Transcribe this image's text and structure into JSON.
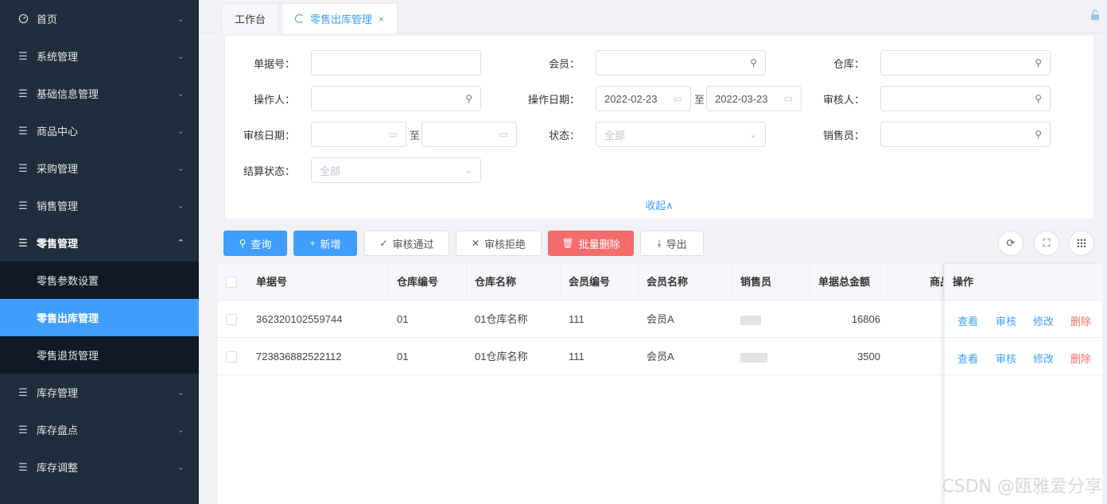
{
  "sidebar": {
    "items": [
      {
        "label": "首页",
        "icon": "dashboard-icon"
      },
      {
        "label": "系统管理",
        "icon": "menu-icon"
      },
      {
        "label": "基础信息管理",
        "icon": "menu-icon"
      },
      {
        "label": "商品中心",
        "icon": "menu-icon"
      },
      {
        "label": "采购管理",
        "icon": "menu-icon"
      },
      {
        "label": "销售管理",
        "icon": "menu-icon"
      },
      {
        "label": "零售管理",
        "icon": "menu-icon",
        "open": true
      },
      {
        "label": "库存管理",
        "icon": "menu-icon"
      },
      {
        "label": "库存盘点",
        "icon": "menu-icon"
      },
      {
        "label": "库存调整",
        "icon": "menu-icon"
      }
    ],
    "submenu": [
      {
        "label": "零售参数设置"
      },
      {
        "label": "零售出库管理",
        "active": true
      },
      {
        "label": "零售退货管理"
      }
    ]
  },
  "tabs": [
    {
      "label": "工作台"
    },
    {
      "label": "零售出库管理",
      "active": true,
      "close": "×"
    }
  ],
  "filter": {
    "order_no_label": "单据号：",
    "member_label": "会员：",
    "warehouse_label": "仓库：",
    "operator_label": "操作人：",
    "op_date_label": "操作日期：",
    "op_date_start": "2022-02-23",
    "op_date_end": "2022-03-23",
    "auditor_label": "审核人：",
    "audit_date_label": "审核日期：",
    "status_label": "状态：",
    "status_placeholder": "全部",
    "salesman_label": "销售员：",
    "settle_label": "结算状态：",
    "settle_placeholder": "全部",
    "to_text": "至",
    "collapse_label": "收起∧"
  },
  "toolbar": {
    "query": "查询",
    "add": "新增",
    "approve": "审核通过",
    "reject": "审核拒绝",
    "batch_delete": "批量删除",
    "export": "导出"
  },
  "table": {
    "columns": [
      "单据号",
      "仓库编号",
      "仓库名称",
      "会员编号",
      "会员名称",
      "销售员",
      "单据总金额",
      "商品",
      "操作"
    ],
    "rows": [
      {
        "order_no": "362320102559744",
        "wh_code": "01",
        "wh_name": "01仓库名称",
        "member_code": "111",
        "member_name": "会员A",
        "amount": "16806"
      },
      {
        "order_no": "723836882522112",
        "wh_code": "01",
        "wh_name": "01仓库名称",
        "member_code": "111",
        "member_name": "会员A",
        "amount": "3500"
      }
    ],
    "ops": {
      "view": "查看",
      "audit": "审核",
      "edit": "修改",
      "delete": "删除"
    }
  },
  "watermark": "CSDN @瓯雅爱分享"
}
